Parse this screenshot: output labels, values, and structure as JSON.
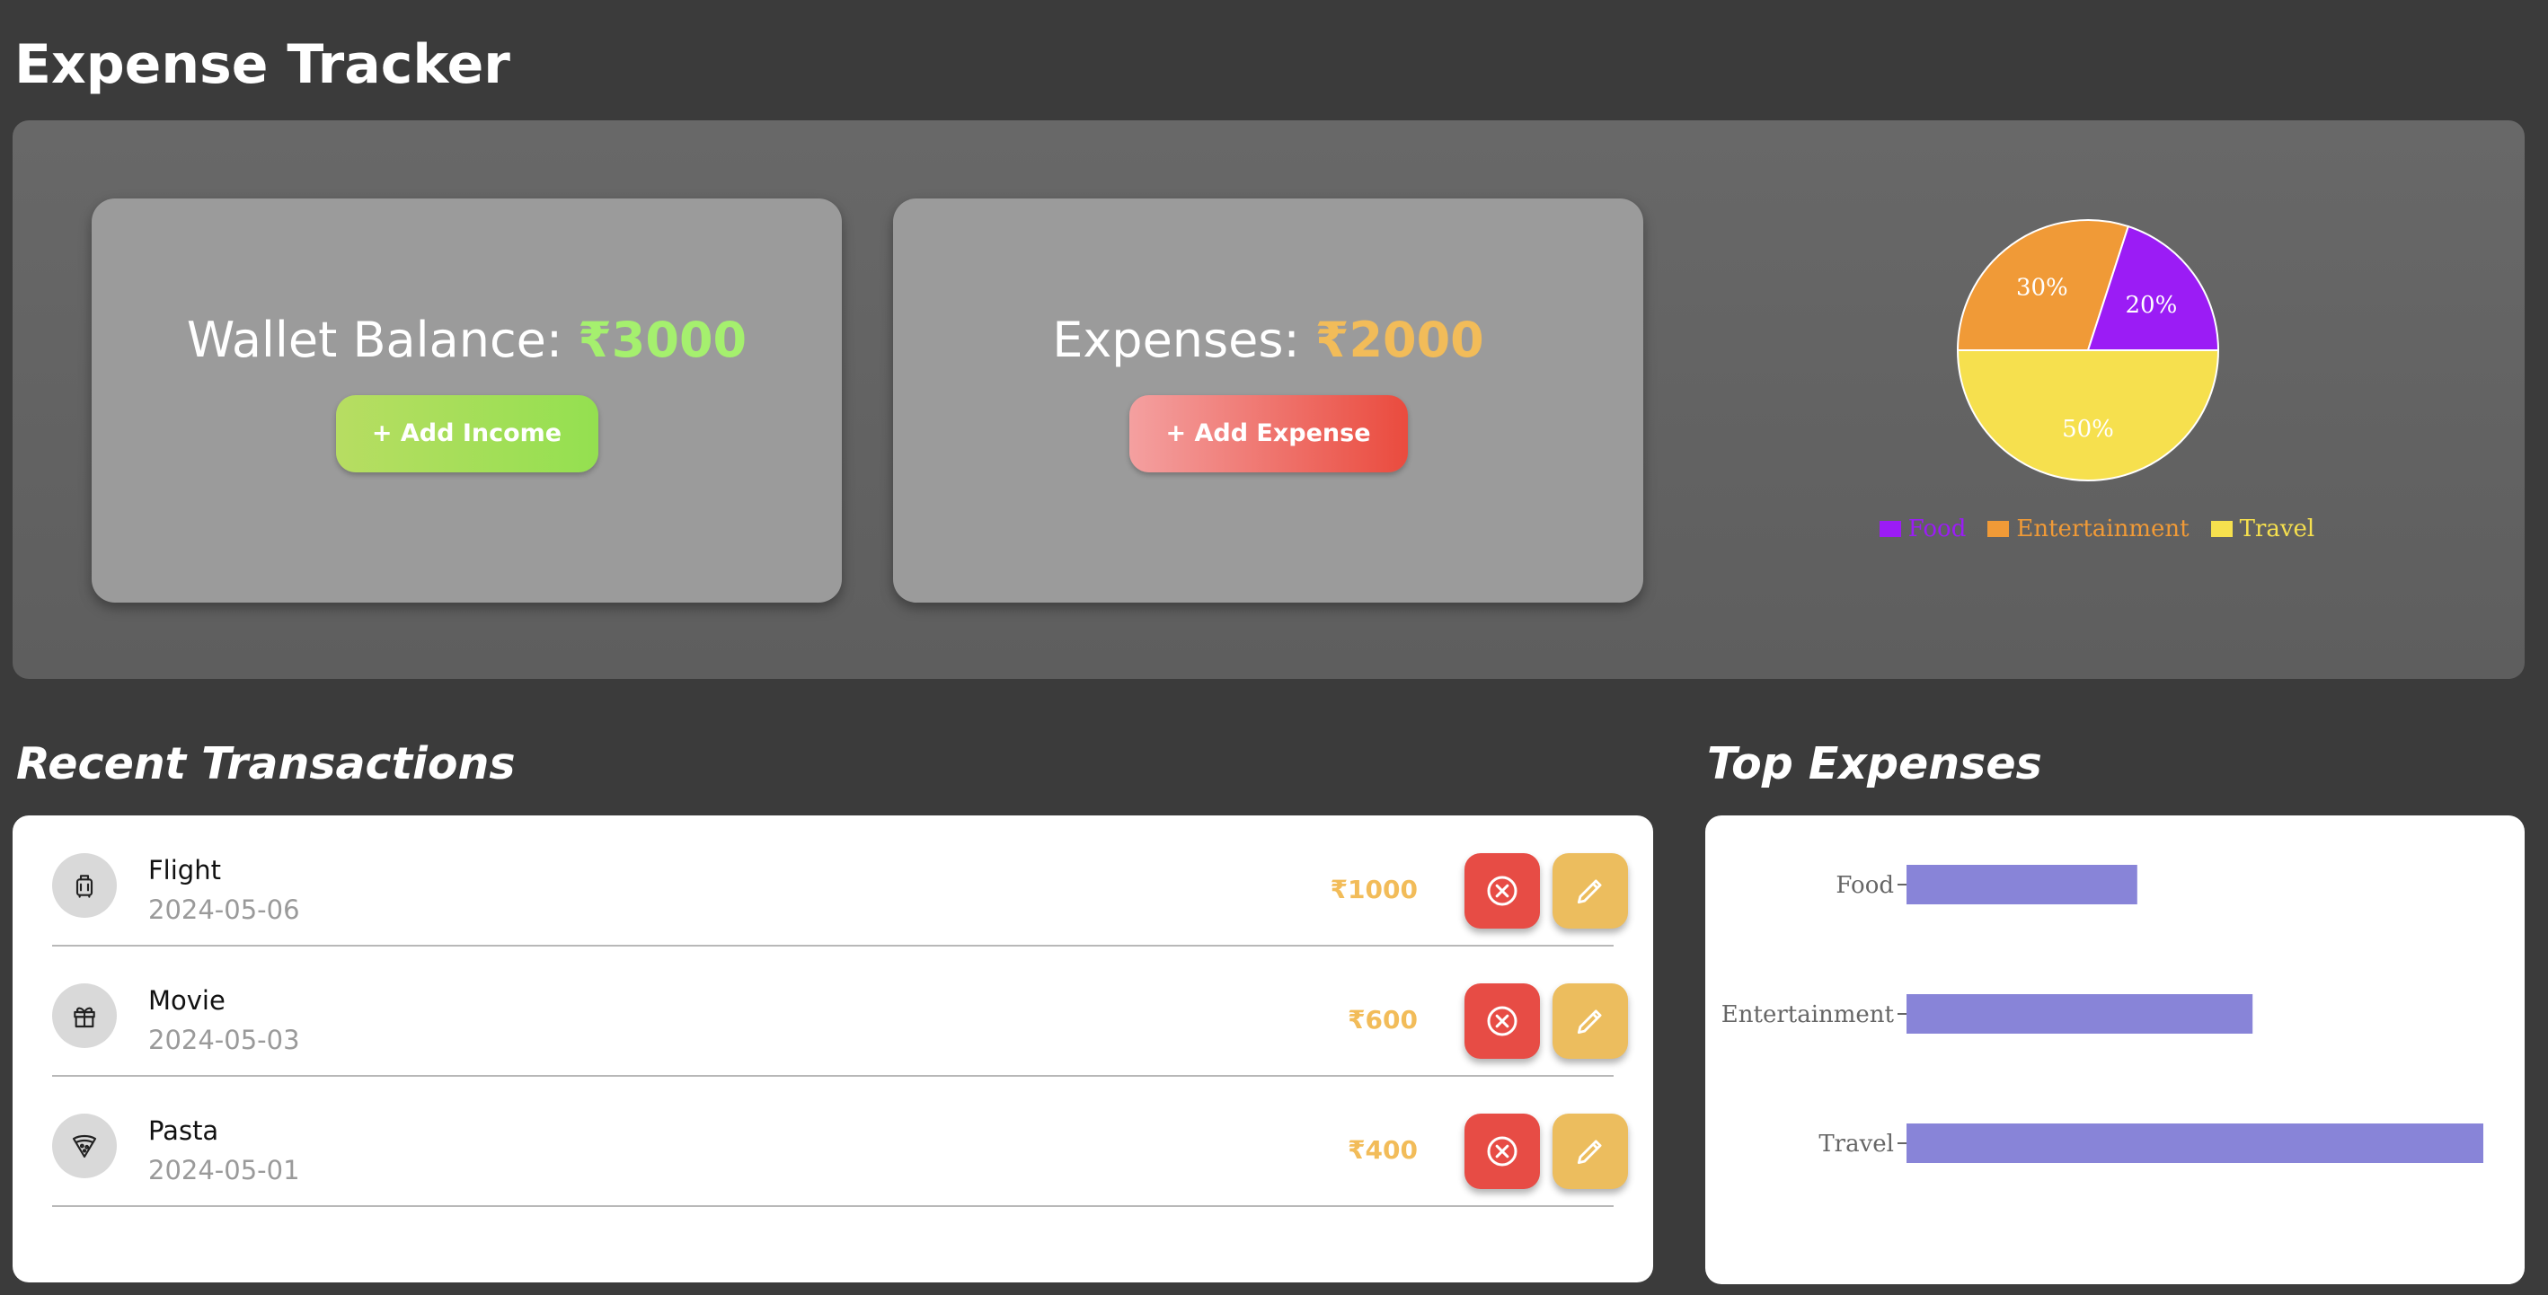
{
  "app": {
    "title": "Expense Tracker"
  },
  "wallet": {
    "label": "Wallet Balance: ",
    "amount": "₹3000",
    "button_label": "+ Add Income"
  },
  "expenses": {
    "label": "Expenses: ",
    "amount": "₹2000",
    "button_label": "+ Add Expense"
  },
  "colors": {
    "income_amount": "#a5f06e",
    "expense_amount": "#f2bc59",
    "delete_button": "#e74c45",
    "edit_button": "#ecbd5e"
  },
  "chart_data": [
    {
      "type": "pie",
      "title": "",
      "slices": [
        {
          "label": "Food",
          "value": 20,
          "label_text": "20%",
          "color": "#9b1cf5"
        },
        {
          "label": "Entertainment",
          "value": 30,
          "label_text": "30%",
          "color": "#f09a37"
        },
        {
          "label": "Travel",
          "value": 50,
          "label_text": "50%",
          "color": "#f6e04e"
        }
      ],
      "legend_placement": "bottom"
    },
    {
      "type": "bar",
      "orientation": "horizontal",
      "title": "",
      "categories": [
        "Food",
        "Entertainment",
        "Travel"
      ],
      "values": [
        400,
        600,
        1000
      ],
      "xlim": [
        0,
        1000
      ],
      "color": "#8884d8",
      "grid": false
    }
  ],
  "sections": {
    "recent_title": "Recent Transactions",
    "top_title": "Top Expenses"
  },
  "transactions": [
    {
      "name": "Flight",
      "date": "2024-05-06",
      "amount": "₹1000",
      "icon": "luggage-icon"
    },
    {
      "name": "Movie",
      "date": "2024-05-03",
      "amount": "₹600",
      "icon": "gift-icon"
    },
    {
      "name": "Pasta",
      "date": "2024-05-01",
      "amount": "₹400",
      "icon": "pizza-icon"
    }
  ]
}
